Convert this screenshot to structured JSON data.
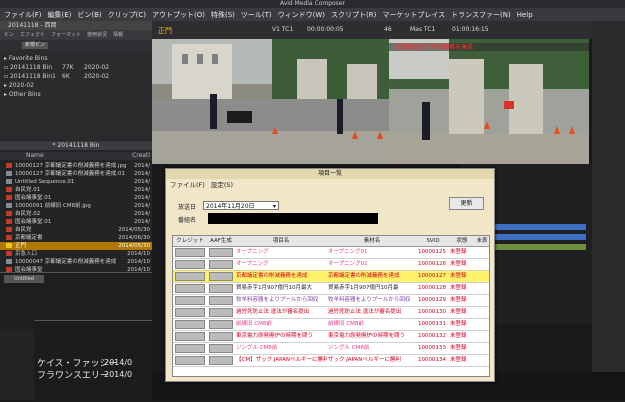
{
  "app": {
    "title": "Avid Media Composer",
    "menu": [
      "ファイル(F)",
      "編集(E)",
      "ビン(B)",
      "クリップ(C)",
      "アウトプット(O)",
      "特殊(S)",
      "ツール(T)",
      "ウィンドウ(W)",
      "スクリプト(R)",
      "マーケットプレイス",
      "トランスファー(N)",
      "Help"
    ]
  },
  "bin": {
    "title": "20141118 - 西岡",
    "tabs": [
      "ビン",
      "エフェクト",
      "フォーマット",
      "使用状況",
      "情報"
    ],
    "new_folder": "新規ビン",
    "rows": [
      {
        "name": "Favorite Bins",
        "size": "",
        "date": ""
      },
      {
        "name": "20141118 Bin",
        "size": "77K",
        "date": "2020-02"
      },
      {
        "name": "20141118 Bin1",
        "size": "6K",
        "date": "2020-02"
      },
      {
        "name": "2020-02",
        "size": "",
        "date": ""
      },
      {
        "name": "Other Bins",
        "size": "",
        "date": ""
      }
    ]
  },
  "clips": {
    "header": "* 20141118 Bin",
    "col_name": "Name",
    "col_date": "Creati",
    "rows": [
      {
        "name": "10000127 京都議定書の削減義務を達成.jpg",
        "date": "2014/",
        "color": "#c0392b",
        "selected": false
      },
      {
        "name": "10000127 京都議定書の削減義務を達成.01",
        "date": "2014/",
        "color": "#7f8c8d",
        "selected": false
      },
      {
        "name": "Untitled Sequence.01",
        "date": "2014/",
        "color": "#7f8c8d",
        "selected": false
      },
      {
        "name": "自民党.01",
        "date": "2014/",
        "color": "#c0392b",
        "selected": false
      },
      {
        "name": "国会議事堂.01",
        "date": "2014/",
        "color": "#c0392b",
        "selected": false
      },
      {
        "name": "10000091 前線旧 CM8前.jpg",
        "date": "2014/",
        "color": "#7f8c8d",
        "selected": false
      },
      {
        "name": "自民党.02",
        "date": "2014/",
        "color": "#c0392b",
        "selected": false
      },
      {
        "name": "国会議事堂.01",
        "date": "2014/",
        "color": "#c0392b",
        "selected": false
      },
      {
        "name": "自民党",
        "date": "2014/05/30",
        "color": "#c0392b",
        "selected": false
      },
      {
        "name": "京都議定書",
        "date": "2014/06/30",
        "color": "#c0392b",
        "selected": false
      },
      {
        "name": "正門",
        "date": "2014/05/30",
        "color": "#f1c40f",
        "selected": true
      },
      {
        "name": "京急入口",
        "date": "2014/10",
        "color": "#c0392b",
        "selected": false
      },
      {
        "name": "10000047 京都議定書の削減義務を達成",
        "date": "2014/10",
        "color": "#7f8c8d",
        "selected": false
      },
      {
        "name": "国会議事堂",
        "date": "2014/10",
        "color": "#c0392b",
        "selected": false
      }
    ]
  },
  "lower": {
    "tab": "Untitled",
    "lines": [
      "ケイス・ファッシー",
      "フラワンスエリー"
    ],
    "dates": [
      "2014/0",
      "2014/0"
    ]
  },
  "monitor": {
    "left_label": "正門",
    "left_tc_label": "V1 TC1",
    "left_tc": "00:00:00:05",
    "count": "46",
    "right_tc_label": "Mas TC1",
    "right_tc": "01:00:16:15",
    "right_title": "京都議定書の削減義務を達成"
  },
  "dialog": {
    "title": "項目一覧",
    "menu": [
      "ファイル(F)",
      "設定(S)"
    ],
    "date_label": "放送日",
    "date_value": "2014年11月20日",
    "number_label": "番組名",
    "update_btn": "更新",
    "columns": [
      "クレジット",
      "AAF生成",
      "項目名",
      "素材名",
      "SVID",
      "状態",
      "未表"
    ],
    "rows": [
      {
        "item": "オープニング",
        "material": "オープニング01",
        "svid": "10000125",
        "status": "未登録",
        "color": "#e8388a",
        "highlight": false
      },
      {
        "item": "オープニング",
        "material": "オープニング02",
        "svid": "10000126",
        "status": "未登録",
        "color": "#e8388a",
        "highlight": false
      },
      {
        "item": "京都議定書の削減義務を達成",
        "material": "京都議定書の削減義務を達成",
        "svid": "10000127",
        "status": "未登録",
        "color": "#d2001e",
        "highlight": true
      },
      {
        "item": "貿易赤字1月907億円10月最大",
        "material": "貿易赤字1月907億円10月最",
        "svid": "10000128",
        "status": "未登録",
        "color": "#222222",
        "highlight": false
      },
      {
        "item": "牧羊料容器をよりプールから回収",
        "material": "牧羊料容器をよりプールから回収",
        "svid": "10000129",
        "status": "未登録",
        "color": "#7a3fa0",
        "highlight": false
      },
      {
        "item": "過労死防止法 違法が審名提出",
        "material": "過労死防止法 違法が審名提出",
        "svid": "10000130",
        "status": "未登録",
        "color": "#d2001e",
        "highlight": false
      },
      {
        "item": "前線旧 CM8前",
        "material": "前線旧 CM8前",
        "svid": "10000131",
        "status": "未登録",
        "color": "#e8388a",
        "highlight": false
      },
      {
        "item": "東京電力原発廃炉の時期を問う",
        "material": "東京電力原発廃炉の時期を問う",
        "svid": "10000132",
        "status": "未登録",
        "color": "#d2001e",
        "highlight": false
      },
      {
        "item": "ジングル CM8前",
        "material": "ジングル CM8前",
        "svid": "10000133",
        "status": "未登録",
        "color": "#e8388a",
        "highlight": false
      },
      {
        "item": "【CM】ザック JAPANベルギーに勝利",
        "material": "ザック JAPANベルギーに勝利",
        "svid": "10000134",
        "status": "未登録",
        "color": "#d2001e",
        "highlight": false
      }
    ]
  }
}
